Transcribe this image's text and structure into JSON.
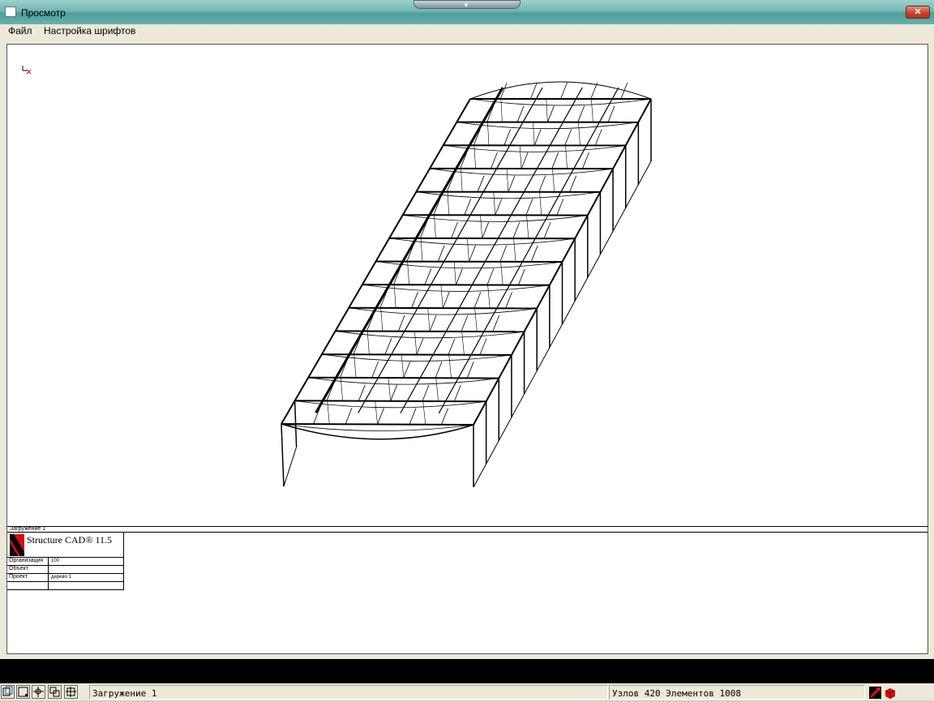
{
  "window": {
    "title": "Просмотр",
    "close_label": "✕"
  },
  "menu": {
    "items": [
      "Файл",
      "Настройка шрифтов"
    ]
  },
  "drawing": {
    "load_case_label": "Загружение 1",
    "product": "Structure CAD® 11.5",
    "title_block": [
      {
        "key": "Организация",
        "value": "100"
      },
      {
        "key": "Объект",
        "value": ""
      },
      {
        "key": "Проект",
        "value": "дерево 1"
      },
      {
        "key": "",
        "value": ""
      }
    ]
  },
  "statusbar": {
    "load_case": "Загружение 1",
    "counts": "Узлов 420 Элементов 1008",
    "buttons": [
      "view-front-icon",
      "select-node-icon",
      "select-element-icon",
      "fragment-icon",
      "restore-icon"
    ]
  },
  "colors": {
    "title_bar": "#6fb7b4",
    "accent_red": "#d01010"
  }
}
